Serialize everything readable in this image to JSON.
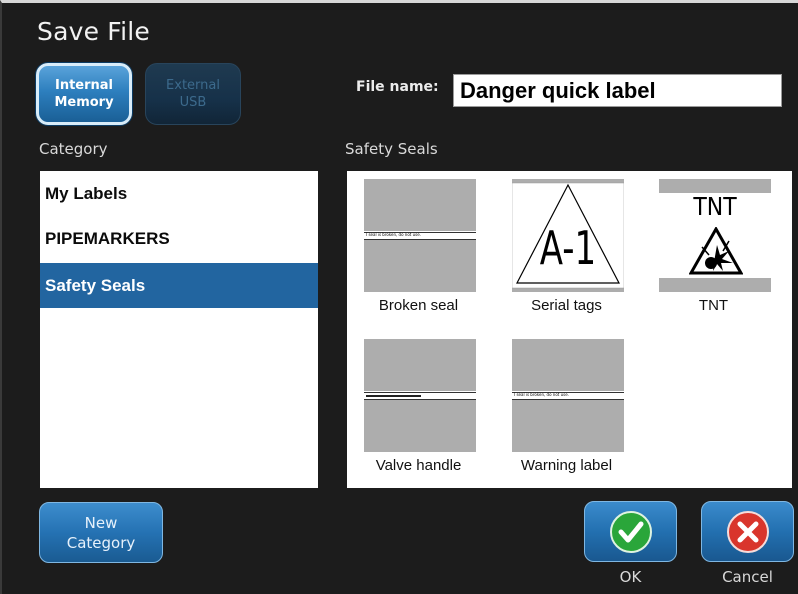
{
  "dialog": {
    "title": "Save File"
  },
  "memory": {
    "internal_label": "Internal\nMemory",
    "external_label": "External\nUSB"
  },
  "filename": {
    "label": "File name:",
    "value": "Danger quick label"
  },
  "category": {
    "heading": "Category",
    "items": [
      {
        "label": "My Labels",
        "selected": false
      },
      {
        "label": "PIPEMARKERS",
        "selected": false
      },
      {
        "label": "Safety Seals",
        "selected": true
      }
    ]
  },
  "files": {
    "heading": "Safety Seals",
    "items": [
      {
        "label": "Broken seal",
        "icon": "broken-seal-thumbnail",
        "strip_text": "I seal is broken, do not use."
      },
      {
        "label": "Serial tags",
        "icon": "serial-tag-triangle-thumbnail",
        "graphic_text": "A-1"
      },
      {
        "label": "TNT",
        "icon": "tnt-explosive-thumbnail",
        "graphic_text": "TNT"
      },
      {
        "label": "Valve handle",
        "icon": "valve-handle-thumbnail"
      },
      {
        "label": "Warning label",
        "icon": "warning-label-thumbnail",
        "strip_text": "I seal is broken, do not use."
      }
    ]
  },
  "buttons": {
    "new_category": "New\nCategory",
    "ok": "OK",
    "cancel": "Cancel"
  },
  "colors": {
    "background": "#1c1c1c",
    "accent_blue": "#2265a0",
    "ok_green": "#2aa63a",
    "cancel_red": "#d9352c"
  }
}
